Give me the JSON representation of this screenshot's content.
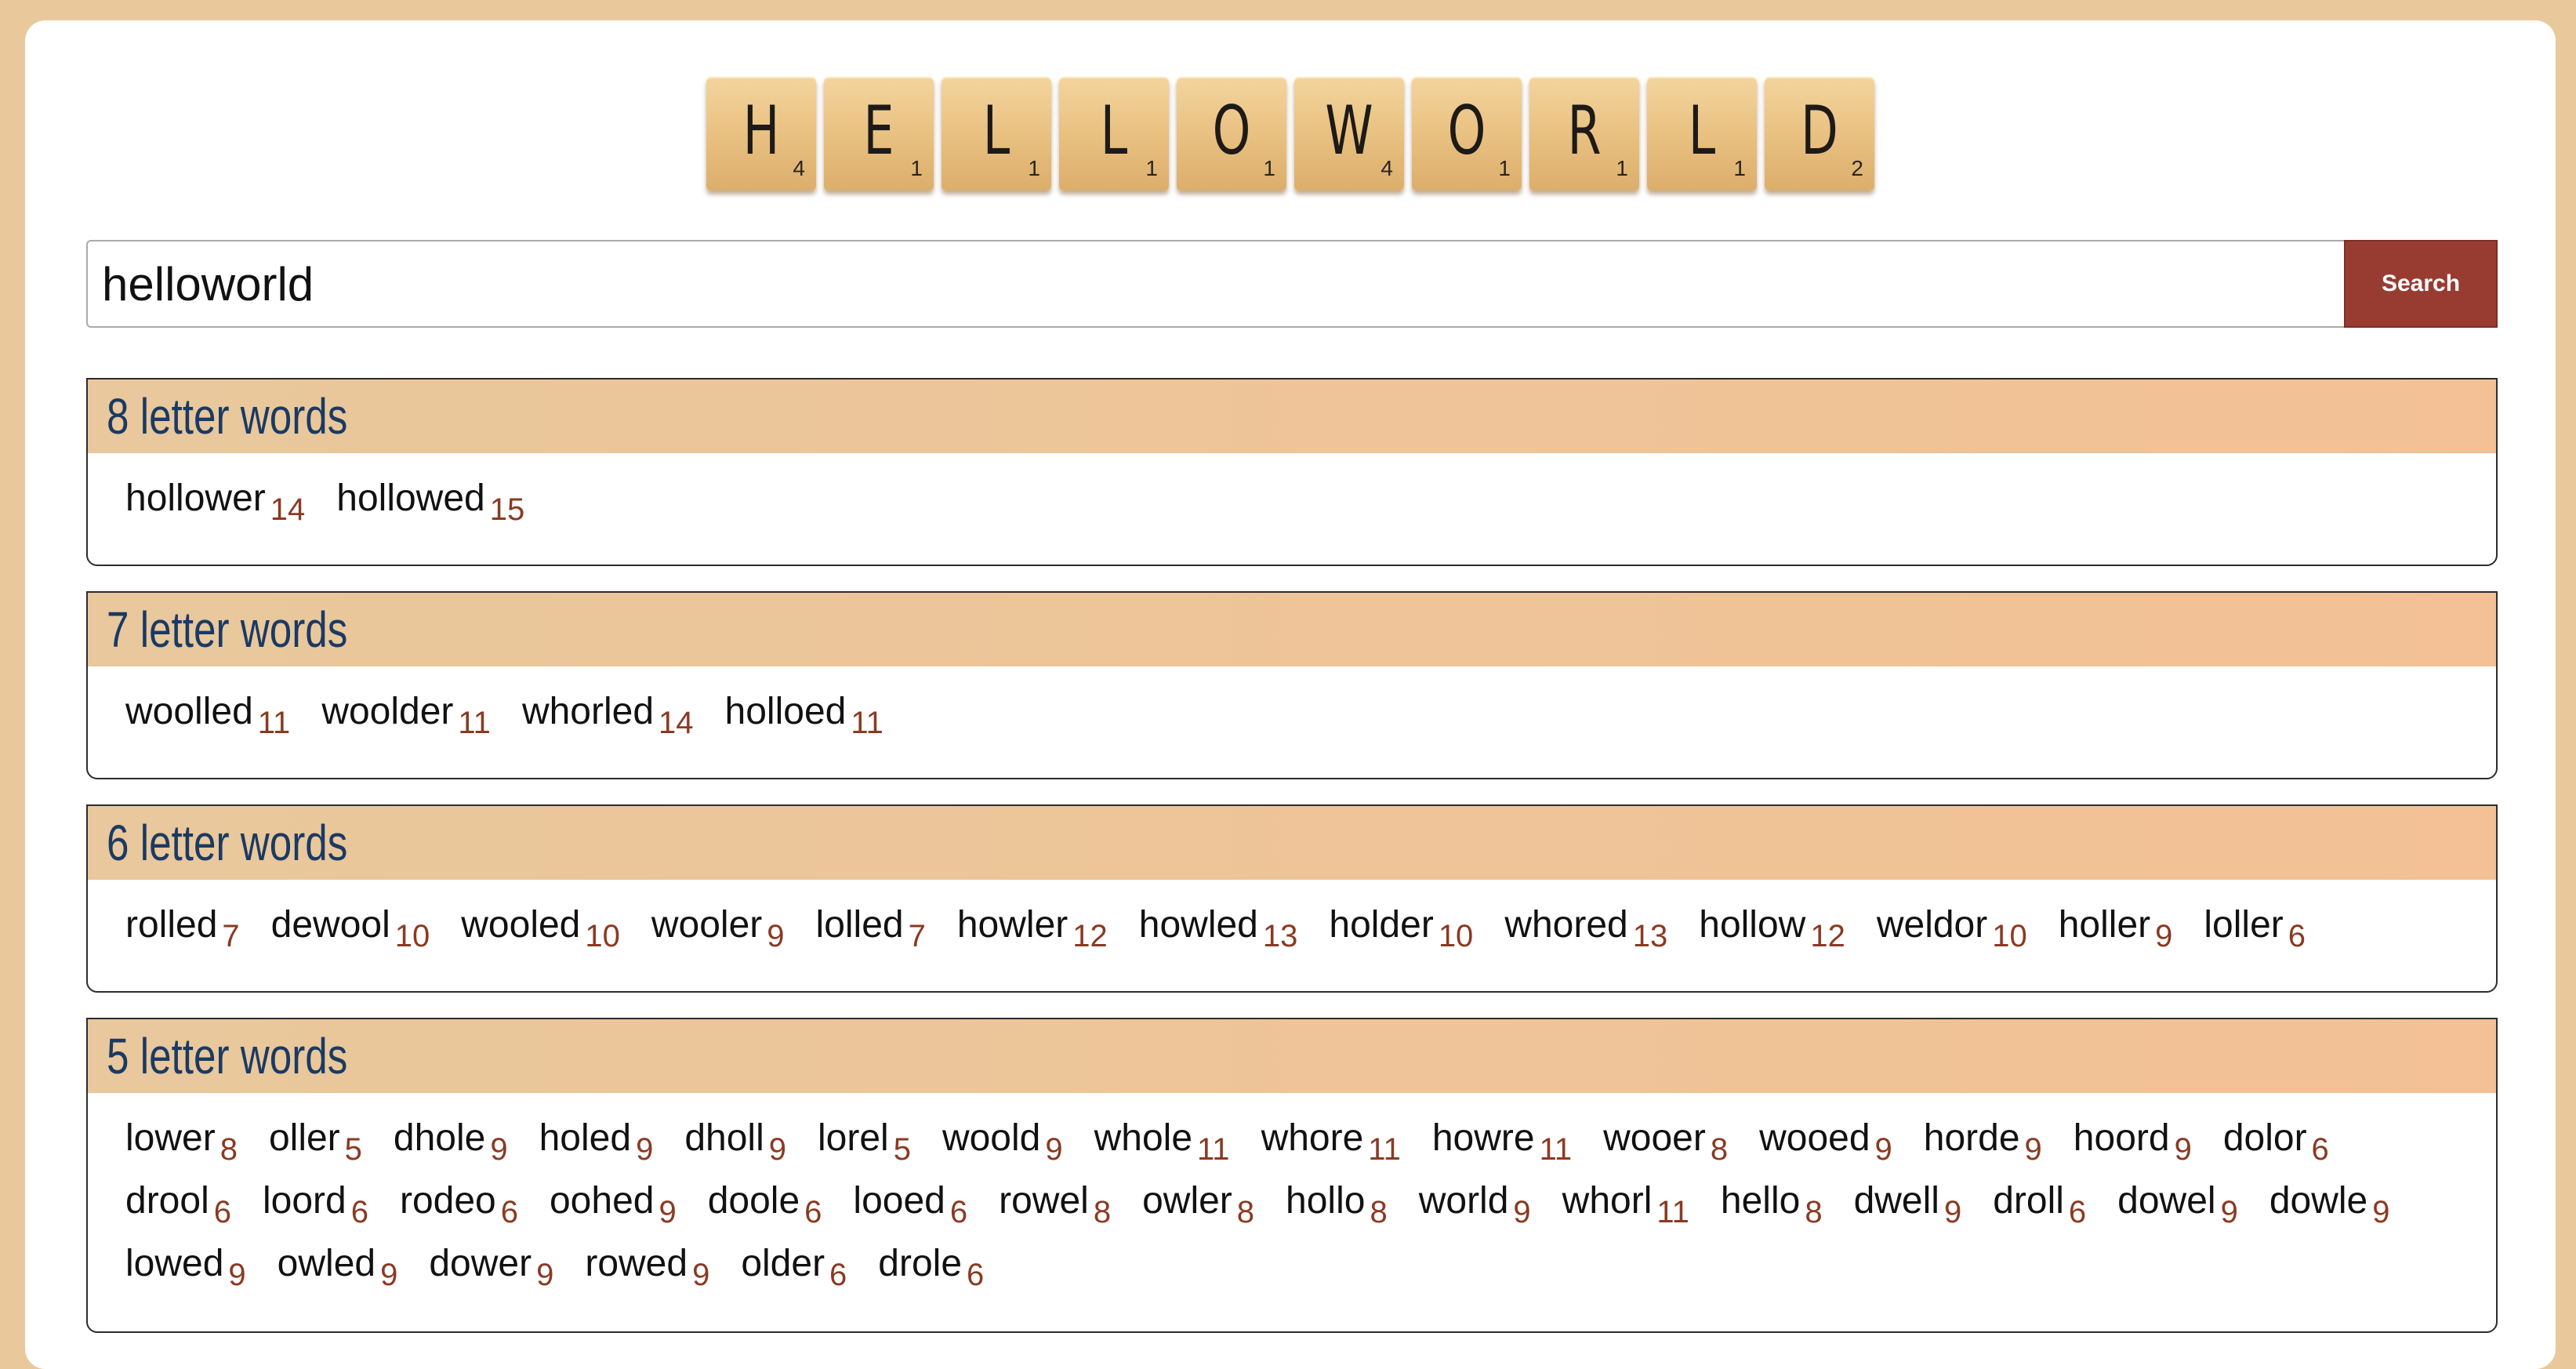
{
  "tiles": [
    {
      "letter": "H",
      "score": "4"
    },
    {
      "letter": "E",
      "score": "1"
    },
    {
      "letter": "L",
      "score": "1"
    },
    {
      "letter": "L",
      "score": "1"
    },
    {
      "letter": "O",
      "score": "1"
    },
    {
      "letter": "W",
      "score": "4"
    },
    {
      "letter": "O",
      "score": "1"
    },
    {
      "letter": "R",
      "score": "1"
    },
    {
      "letter": "L",
      "score": "1"
    },
    {
      "letter": "D",
      "score": "2"
    }
  ],
  "search": {
    "value": "helloworld",
    "button_label": "Search"
  },
  "groups": [
    {
      "title": "8 letter words",
      "words": [
        {
          "w": "hollower",
          "s": "14"
        },
        {
          "w": "hollowed",
          "s": "15"
        }
      ]
    },
    {
      "title": "7 letter words",
      "words": [
        {
          "w": "woolled",
          "s": "11"
        },
        {
          "w": "woolder",
          "s": "11"
        },
        {
          "w": "whorled",
          "s": "14"
        },
        {
          "w": "holloed",
          "s": "11"
        }
      ]
    },
    {
      "title": "6 letter words",
      "words": [
        {
          "w": "rolled",
          "s": "7"
        },
        {
          "w": "dewool",
          "s": "10"
        },
        {
          "w": "wooled",
          "s": "10"
        },
        {
          "w": "wooler",
          "s": "9"
        },
        {
          "w": "lolled",
          "s": "7"
        },
        {
          "w": "howler",
          "s": "12"
        },
        {
          "w": "howled",
          "s": "13"
        },
        {
          "w": "holder",
          "s": "10"
        },
        {
          "w": "whored",
          "s": "13"
        },
        {
          "w": "hollow",
          "s": "12"
        },
        {
          "w": "weldor",
          "s": "10"
        },
        {
          "w": "holler",
          "s": "9"
        },
        {
          "w": "loller",
          "s": "6"
        }
      ]
    },
    {
      "title": "5 letter words",
      "words": [
        {
          "w": "lower",
          "s": "8"
        },
        {
          "w": "oller",
          "s": "5"
        },
        {
          "w": "dhole",
          "s": "9"
        },
        {
          "w": "holed",
          "s": "9"
        },
        {
          "w": "dholl",
          "s": "9"
        },
        {
          "w": "lorel",
          "s": "5"
        },
        {
          "w": "woold",
          "s": "9"
        },
        {
          "w": "whole",
          "s": "11"
        },
        {
          "w": "whore",
          "s": "11"
        },
        {
          "w": "howre",
          "s": "11"
        },
        {
          "w": "wooer",
          "s": "8"
        },
        {
          "w": "wooed",
          "s": "9"
        },
        {
          "w": "horde",
          "s": "9"
        },
        {
          "w": "hoord",
          "s": "9"
        },
        {
          "w": "dolor",
          "s": "6"
        },
        {
          "w": "drool",
          "s": "6"
        },
        {
          "w": "loord",
          "s": "6"
        },
        {
          "w": "rodeo",
          "s": "6"
        },
        {
          "w": "oohed",
          "s": "9"
        },
        {
          "w": "doole",
          "s": "6"
        },
        {
          "w": "looed",
          "s": "6"
        },
        {
          "w": "rowel",
          "s": "8"
        },
        {
          "w": "owler",
          "s": "8"
        },
        {
          "w": "hollo",
          "s": "8"
        },
        {
          "w": "world",
          "s": "9"
        },
        {
          "w": "whorl",
          "s": "11"
        },
        {
          "w": "hello",
          "s": "8"
        },
        {
          "w": "dwell",
          "s": "9"
        },
        {
          "w": "droll",
          "s": "6"
        },
        {
          "w": "dowel",
          "s": "9"
        },
        {
          "w": "dowle",
          "s": "9"
        },
        {
          "w": "lowed",
          "s": "9"
        },
        {
          "w": "owled",
          "s": "9"
        },
        {
          "w": "dower",
          "s": "9"
        },
        {
          "w": "rowed",
          "s": "9"
        },
        {
          "w": "older",
          "s": "6"
        },
        {
          "w": "drole",
          "s": "6"
        }
      ]
    }
  ]
}
